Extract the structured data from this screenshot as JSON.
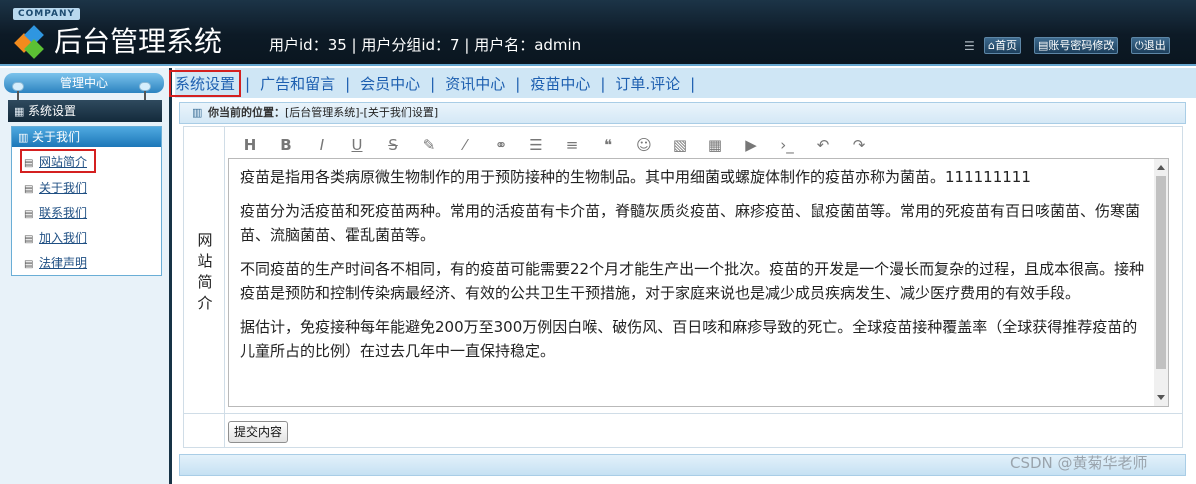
{
  "header": {
    "company": "COMPANY",
    "app_title": "后台管理系统",
    "user_info": "用户id：35 | 用户分组id：7 | 用户名：admin",
    "buttons": {
      "home": "首页",
      "account": "账号密码修改",
      "logout": "退出"
    }
  },
  "sidebar": {
    "header": "管理中心",
    "system": "系统设置",
    "group": "关于我们",
    "items": [
      {
        "label": "网站简介"
      },
      {
        "label": "关于我们"
      },
      {
        "label": "联系我们"
      },
      {
        "label": "加入我们"
      },
      {
        "label": "法律声明"
      }
    ]
  },
  "topnav": {
    "tabs": [
      {
        "label": "系统设置"
      },
      {
        "label": "广告和留言"
      },
      {
        "label": "会员中心"
      },
      {
        "label": "资讯中心"
      },
      {
        "label": "疫苗中心"
      },
      {
        "label": "订单.评论"
      }
    ]
  },
  "breadcrumb": {
    "label": "你当前的位置：",
    "path": "[后台管理系统]-[关于我们设置]"
  },
  "form": {
    "field_label": [
      "网",
      "站",
      "简",
      "介"
    ],
    "editor_paragraphs": [
      "疫苗是指用各类病原微生物制作的用于预防接种的生物制品。其中用细菌或螺旋体制作的疫苗亦称为菌苗。111111111",
      "疫苗分为活疫苗和死疫苗两种。常用的活疫苗有卡介苗，脊髓灰质炎疫苗、麻疹疫苗、鼠疫菌苗等。常用的死疫苗有百日咳菌苗、伤寒菌苗、流脑菌苗、霍乱菌苗等。",
      "不同疫苗的生产时间各不相同，有的疫苗可能需要22个月才能生产出一个批次。疫苗的开发是一个漫长而复杂的过程，且成本很高。接种疫苗是预防和控制传染病最经济、有效的公共卫生干预措施，对于家庭来说也是减少成员疾病发生、减少医疗费用的有效手段。",
      "据估计，免疫接种每年能避免200万至300万例因白喉、破伤风、百日咳和麻疹导致的死亡。全球疫苗接种覆盖率（全球获得推荐疫苗的儿童所占的比例）在过去几年中一直保持稳定。"
    ],
    "submit_label": "提交内容"
  },
  "toolbar_icons": [
    "heading-icon",
    "bold-icon",
    "italic-icon",
    "underline-icon",
    "strikethrough-icon",
    "highlight-pen-icon",
    "brush-icon",
    "link-icon",
    "bullet-list-icon",
    "align-left-icon",
    "quote-icon",
    "emoji-icon",
    "image-icon",
    "table-icon",
    "video-icon",
    "code-icon",
    "undo-icon",
    "redo-icon"
  ],
  "watermark": "CSDN @黄菊华老师"
}
